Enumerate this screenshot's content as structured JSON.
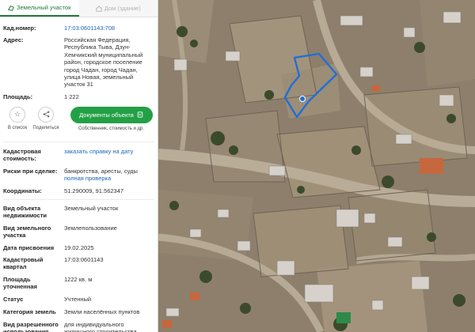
{
  "tabs": [
    {
      "label": "Земельный участок",
      "active": true
    },
    {
      "label": "Дом (здание)",
      "active": false
    }
  ],
  "fields_top": [
    {
      "label": "Кад.номер:",
      "value": "17:03:0601143:708",
      "link": true
    },
    {
      "label": "Адрес:",
      "value": "Российская Федерация, Республика Тыва, Дзун-Хемчикский муниципальный район, городское поселение город Чадан, город Чадан, улица Новая, земельный участок 31",
      "link": false
    },
    {
      "label": "Площадь:",
      "value": "1 222",
      "link": false
    }
  ],
  "actions": {
    "favorite_label": "В список",
    "share_label": "Поделиться",
    "docs_button": "Документы объекта",
    "docs_sub": "Собственник, стоимость и др."
  },
  "fields_mid": [
    {
      "label": "Кадастровая стоимость:",
      "value": "заказать справку на дату",
      "link": true
    },
    {
      "label": "Риски при сделке:",
      "value": "банкротства, аресты, суды",
      "sub": "полная проверка"
    },
    {
      "label": "Координаты:",
      "value": "51.290009, 91.562347",
      "link": false
    }
  ],
  "fields_bottom": [
    {
      "label": "Вид объекта недвижимости",
      "value": "Земельный участок"
    },
    {
      "label": "Вид земельного участка",
      "value": "Землепользование"
    },
    {
      "label": "Дата присвоения",
      "value": "19.02.2025"
    },
    {
      "label": "Кадастровый квартал",
      "value": "17:03:0601143"
    },
    {
      "label": "Площадь уточненная",
      "value": "1222 кв. м"
    },
    {
      "label": "Статус",
      "value": "Учтенный"
    },
    {
      "label": "Категория земель",
      "value": "Земли населённых пунктов"
    },
    {
      "label": "Вид разрешенного использования",
      "value": "для индивидуального жилищного строительства"
    }
  ],
  "colors": {
    "accent_green": "#23a046",
    "link_blue": "#1a65b5",
    "parcel_outline": "#1f6fd6",
    "map_ground": "#8b7d6b"
  },
  "icons": {
    "land_tab": "land-parcel-icon",
    "house_tab": "house-icon",
    "favorite": "star-icon",
    "share": "share-icon",
    "docs": "document-icon",
    "marker": "location-marker-icon"
  }
}
